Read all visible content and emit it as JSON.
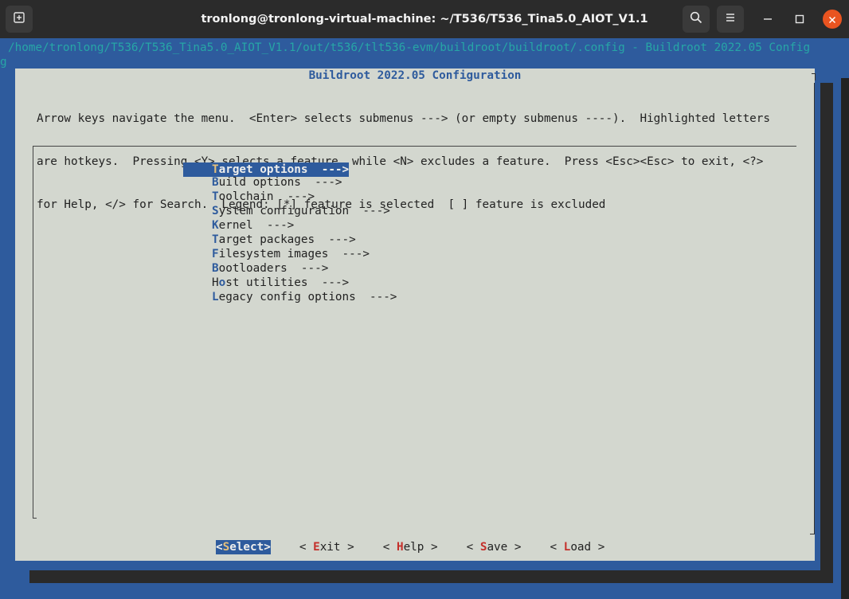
{
  "window": {
    "title": "tronlong@tronlong-virtual-machine: ~/T536/T536_Tina5.0_AIOT_V1.1"
  },
  "terminal": {
    "header_line": "/home/tronlong/T536/T536_Tina5.0_AIOT_V1.1/out/t536/tlt536-evm/buildroot/buildroot/.config - Buildroot 2022.05 Config",
    "header_wrap": "g"
  },
  "dialog": {
    "title": "Buildroot 2022.05 Configuration",
    "help_lines": [
      "Arrow keys navigate the menu.  <Enter> selects submenus ---> (or empty submenus ----).  Highlighted letters",
      "are hotkeys.  Pressing <Y> selects a feature, while <N> excludes a feature.  Press <Esc><Esc> to exit, <?>",
      "for Help, </> for Search.  Legend: [*] feature is selected  [ ] feature is excluded"
    ],
    "menu_items": [
      {
        "pre": "",
        "hotkey": "T",
        "rest": "arget options  --->",
        "selected": true
      },
      {
        "pre": "",
        "hotkey": "B",
        "rest": "uild options  --->",
        "selected": false
      },
      {
        "pre": "",
        "hotkey": "T",
        "rest": "oolchain  --->",
        "selected": false
      },
      {
        "pre": "",
        "hotkey": "S",
        "rest": "ystem configuration  --->",
        "selected": false
      },
      {
        "pre": "",
        "hotkey": "K",
        "rest": "ernel  --->",
        "selected": false
      },
      {
        "pre": "",
        "hotkey": "T",
        "rest": "arget packages  --->",
        "selected": false
      },
      {
        "pre": "",
        "hotkey": "F",
        "rest": "ilesystem images  --->",
        "selected": false
      },
      {
        "pre": "",
        "hotkey": "B",
        "rest": "ootloaders  --->",
        "selected": false
      },
      {
        "pre": "H",
        "hotkey": "o",
        "rest": "st utilities  --->",
        "selected": false
      },
      {
        "pre": "",
        "hotkey": "L",
        "rest": "egacy config options  --->",
        "selected": false
      }
    ],
    "buttons": [
      {
        "left": "<",
        "hotkey": "S",
        "rest": "elect>",
        "selected": true
      },
      {
        "left": "< ",
        "hotkey": "E",
        "rest": "xit >",
        "selected": false
      },
      {
        "left": "< ",
        "hotkey": "H",
        "rest": "elp >",
        "selected": false
      },
      {
        "left": "< ",
        "hotkey": "S",
        "rest": "ave >",
        "selected": false
      },
      {
        "left": "< ",
        "hotkey": "L",
        "rest": "oad >",
        "selected": false
      }
    ]
  },
  "icons": {
    "new_tab": "new-tab-icon",
    "search": "search-icon",
    "menu": "hamburger-menu-icon",
    "minimize": "minimize-icon",
    "maximize": "maximize-icon",
    "close": "close-icon"
  },
  "colors": {
    "terminal_bg": "#2e5b9d",
    "dialog_bg": "#d3d7cf",
    "accent_close": "#e95420",
    "hotkey_menu": "#2e5b9d",
    "hotkey_button": "#c4302b"
  }
}
